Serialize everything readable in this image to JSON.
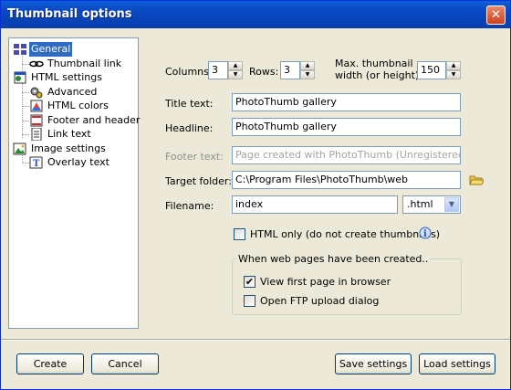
{
  "window": {
    "title": "Thumbnail options",
    "close_label": "✕"
  },
  "tree": {
    "general": "General",
    "thumbnail_link": "Thumbnail link",
    "html_settings": "HTML settings",
    "advanced": "Advanced",
    "html_colors": "HTML colors",
    "footer_header": "Footer and header",
    "link_text": "Link text",
    "image_settings": "Image settings",
    "overlay_text": "Overlay text"
  },
  "general": {
    "columns_label": "Columns:",
    "columns_value": "3",
    "rows_label": "Rows:",
    "rows_value": "3",
    "max_thumb_label_1": "Max. thumbnail",
    "max_thumb_label_2": "width (or height):",
    "max_thumb_value": "150",
    "title_text_label": "Title text:",
    "title_text_value": "PhotoThumb gallery",
    "headline_label": "Headline:",
    "headline_value": "PhotoThumb gallery",
    "footer_text_label": "Footer text:",
    "footer_text_value": "Page created with PhotoThumb (Unregistered Trial Ve",
    "target_folder_label": "Target folder:",
    "target_folder_value": "C:\\Program Files\\PhotoThumb\\web",
    "filename_label": "Filename:",
    "filename_value": "index",
    "extension_value": ".html",
    "html_only_label": "HTML only (do not create thumbnails)",
    "html_only_checked": false,
    "group_title": "When web pages have been created..",
    "view_first_label": "View first page in browser",
    "view_first_checked": true,
    "ftp_label": "Open FTP upload dialog",
    "ftp_checked": false
  },
  "buttons": {
    "create": "Create",
    "cancel": "Cancel",
    "save_settings": "Save settings",
    "load_settings": "Load settings"
  }
}
